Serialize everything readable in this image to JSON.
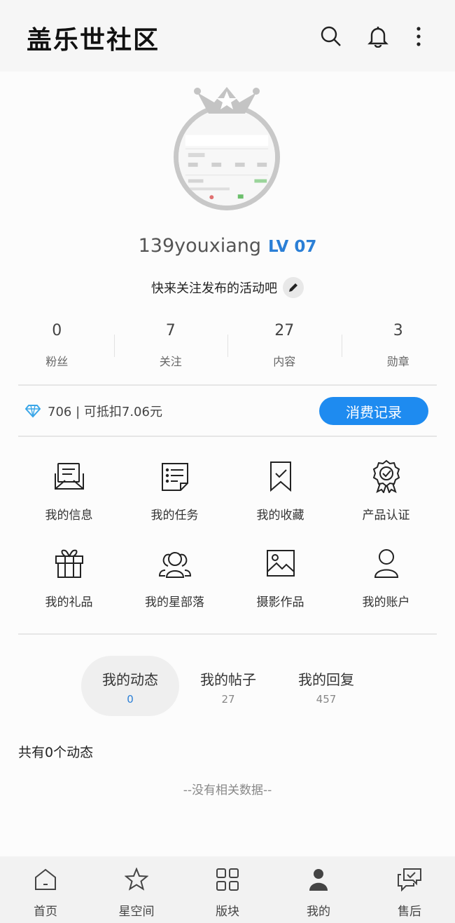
{
  "header": {
    "title": "盖乐世社区",
    "icons": [
      "search-icon",
      "bell-icon",
      "more-icon"
    ]
  },
  "profile": {
    "username": "139youxiang",
    "level": "LV 07",
    "bio": "快来关注发布的活动吧"
  },
  "stats": [
    {
      "value": "0",
      "label": "粉丝"
    },
    {
      "value": "7",
      "label": "关注"
    },
    {
      "value": "27",
      "label": "内容"
    },
    {
      "value": "3",
      "label": "勋章"
    }
  ],
  "points": {
    "text": "706 | 可抵扣7.06元",
    "button_label": "消费记录"
  },
  "menu": [
    {
      "label": "我的信息",
      "icon": "message-icon"
    },
    {
      "label": "我的任务",
      "icon": "task-list-icon"
    },
    {
      "label": "我的收藏",
      "icon": "bookmark-icon"
    },
    {
      "label": "产品认证",
      "icon": "badge-icon"
    },
    {
      "label": "我的礼品",
      "icon": "gift-icon"
    },
    {
      "label": "我的星部落",
      "icon": "group-icon"
    },
    {
      "label": "摄影作品",
      "icon": "image-icon"
    },
    {
      "label": "我的账户",
      "icon": "account-icon"
    }
  ],
  "tabs": [
    {
      "label": "我的动态",
      "count": "0",
      "active": true
    },
    {
      "label": "我的帖子",
      "count": "27",
      "active": false
    },
    {
      "label": "我的回复",
      "count": "457",
      "active": false
    }
  ],
  "feed": {
    "count_text": "共有0个动态",
    "empty_text": "--没有相关数据--"
  },
  "bottom_nav": [
    {
      "label": "首页",
      "icon": "home-icon"
    },
    {
      "label": "星空间",
      "icon": "star-icon"
    },
    {
      "label": "版块",
      "icon": "grid-icon"
    },
    {
      "label": "我的",
      "icon": "person-icon",
      "active": true
    },
    {
      "label": "售后",
      "icon": "service-chat-icon"
    }
  ],
  "colors": {
    "accent": "#2b7fd6",
    "button": "#1e8bf0",
    "diamond": "#3aa6e8"
  }
}
